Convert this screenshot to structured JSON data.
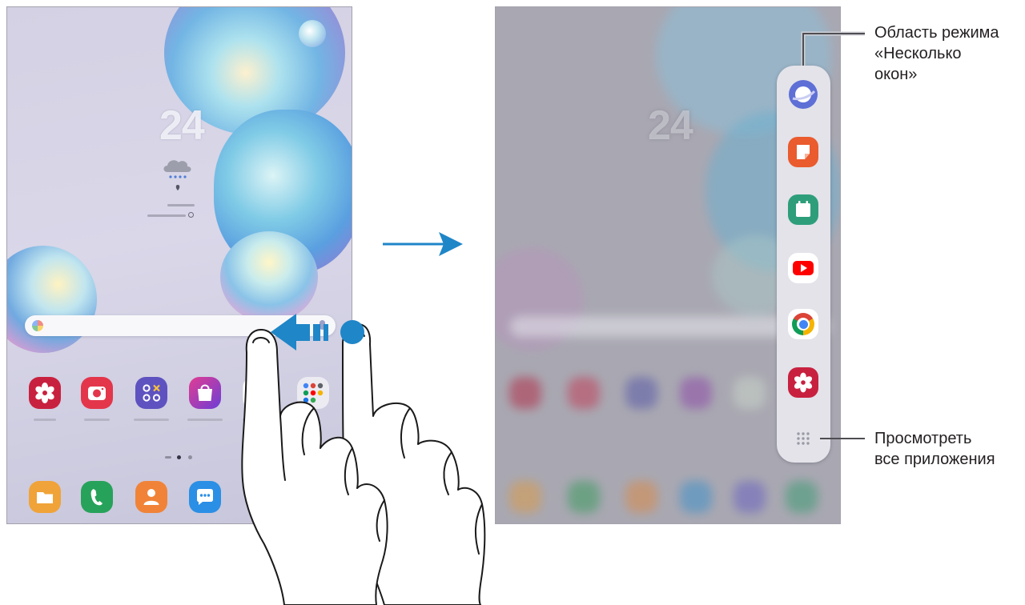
{
  "left_screen": {
    "clock": "24",
    "weather_icon": "rain-cloud-icon",
    "location_icon": "location-pin-icon",
    "home_apps": [
      {
        "app": "gallery",
        "icon": "flower-icon",
        "color": "#c8213f"
      },
      {
        "app": "camera",
        "icon": "camera-icon",
        "color": "#e3364b"
      },
      {
        "app": "tools",
        "icon": "shapes-icon",
        "color": "#5e52c0"
      },
      {
        "app": "store",
        "icon": "shopping-bag-icon",
        "color": "#9b3fcf"
      },
      {
        "app": "play",
        "icon": "play-icon",
        "color": "#ffffff"
      },
      {
        "app": "folder",
        "icon": "app-folder-icon",
        "color": "#ecebf2"
      }
    ],
    "dock_apps": [
      {
        "app": "files",
        "icon": "folder-icon",
        "color": "#f0a338"
      },
      {
        "app": "phone",
        "icon": "phone-icon",
        "color": "#27a25a"
      },
      {
        "app": "contacts",
        "icon": "person-icon",
        "color": "#f08338"
      },
      {
        "app": "messages",
        "icon": "chat-bubble-icon",
        "color": "#2b8fe5"
      }
    ],
    "page_indicator": {
      "pages": 3,
      "current": 2
    }
  },
  "right_screen": {
    "clock": "24",
    "multi_window_apps": [
      {
        "app": "internet",
        "icon": "planet-icon",
        "color": "#5e6fd6"
      },
      {
        "app": "notes",
        "icon": "note-icon",
        "color": "#ea5b2e"
      },
      {
        "app": "calendar",
        "icon": "calendar-icon",
        "color": "#2e9e7a"
      },
      {
        "app": "youtube",
        "icon": "youtube-icon",
        "color": "#ff0000"
      },
      {
        "app": "chrome",
        "icon": "chrome-icon",
        "color": "#4285f4"
      },
      {
        "app": "gallery",
        "icon": "flower-icon",
        "color": "#c8213f"
      },
      {
        "app": "all-apps",
        "icon": "apps-grid-icon",
        "color": "#9a9aa6"
      }
    ]
  },
  "gesture": {
    "direction": "swipe-left",
    "icons": [
      "swipe-arrow-icon",
      "touch-point-icon",
      "hand-icon"
    ]
  },
  "transition_arrow_icon": "arrow-right-icon",
  "callouts": {
    "multi_window_area": {
      "line1": "Область режима",
      "line2": "«Несколько",
      "line3": "окон»"
    },
    "view_all_apps": {
      "line1": "Просмотреть",
      "line2": "все приложения"
    }
  },
  "colors": {
    "accent_blue": "#1f86c8",
    "callout_text": "#231f20",
    "callout_line": "#5a5a5a"
  }
}
